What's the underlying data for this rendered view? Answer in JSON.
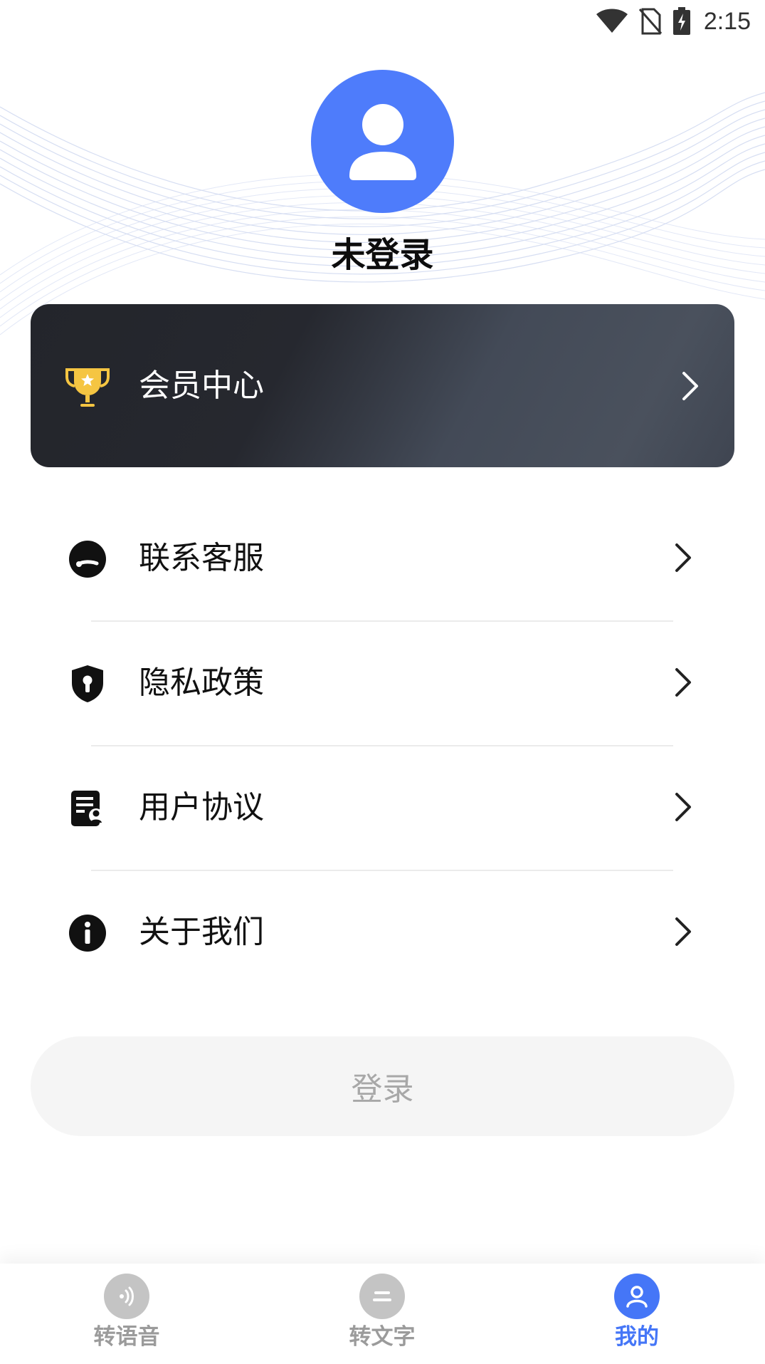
{
  "status_bar": {
    "time": "2:15",
    "icons": [
      "wifi-icon",
      "no-sim-icon",
      "battery-charging-icon"
    ]
  },
  "profile": {
    "avatar_icon": "user-avatar-icon",
    "username": "未登录"
  },
  "vip": {
    "icon": "trophy-icon",
    "label": "会员中心"
  },
  "menu": {
    "items": [
      {
        "icon": "headset-service-icon",
        "label": "联系客服"
      },
      {
        "icon": "shield-lock-icon",
        "label": "隐私政策"
      },
      {
        "icon": "document-user-icon",
        "label": "用户协议"
      },
      {
        "icon": "info-icon",
        "label": "关于我们"
      }
    ]
  },
  "login": {
    "label": "登录"
  },
  "tab_bar": {
    "active": "我的",
    "tabs": [
      {
        "icon": "voice-wave-icon",
        "label": "转语音"
      },
      {
        "icon": "text-lines-icon",
        "label": "转文字"
      },
      {
        "icon": "user-icon",
        "label": "我的"
      }
    ]
  },
  "colors": {
    "accent": "#4576f7",
    "avatar_bg": "#4e7cfb",
    "vip_card_bg": "#2a2d34",
    "trophy": "#f5c542",
    "login_bg": "#f5f5f5",
    "login_text": "#a8a8a8",
    "inactive_tab": "#c4c4c4"
  }
}
